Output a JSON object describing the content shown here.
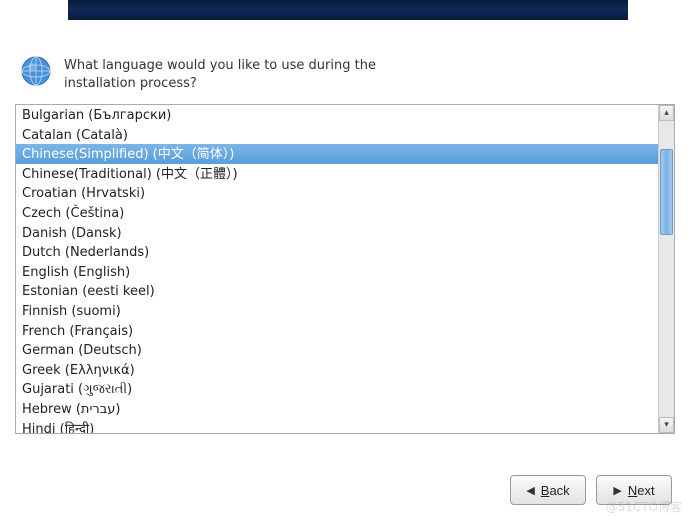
{
  "prompt": {
    "line1": "What language would you like to use during the",
    "line2": "installation process?"
  },
  "languages": [
    {
      "label": "Bulgarian (Български)",
      "selected": false
    },
    {
      "label": "Catalan (Català)",
      "selected": false
    },
    {
      "label": "Chinese(Simplified) (中文（简体）)",
      "selected": true
    },
    {
      "label": "Chinese(Traditional) (中文（正體）)",
      "selected": false
    },
    {
      "label": "Croatian (Hrvatski)",
      "selected": false
    },
    {
      "label": "Czech (Čeština)",
      "selected": false
    },
    {
      "label": "Danish (Dansk)",
      "selected": false
    },
    {
      "label": "Dutch (Nederlands)",
      "selected": false
    },
    {
      "label": "English (English)",
      "selected": false
    },
    {
      "label": "Estonian (eesti keel)",
      "selected": false
    },
    {
      "label": "Finnish (suomi)",
      "selected": false
    },
    {
      "label": "French (Français)",
      "selected": false
    },
    {
      "label": "German (Deutsch)",
      "selected": false
    },
    {
      "label": "Greek (Ελληνικά)",
      "selected": false
    },
    {
      "label": "Gujarati (ગુજરાતી)",
      "selected": false
    },
    {
      "label": "Hebrew (עברית)",
      "selected": false
    },
    {
      "label": "Hindi (हिन्दी)",
      "selected": false
    }
  ],
  "buttons": {
    "back": {
      "accel": "B",
      "rest": "ack"
    },
    "next": {
      "accel": "N",
      "rest": "ext"
    }
  },
  "watermark": "@51CTO博客"
}
